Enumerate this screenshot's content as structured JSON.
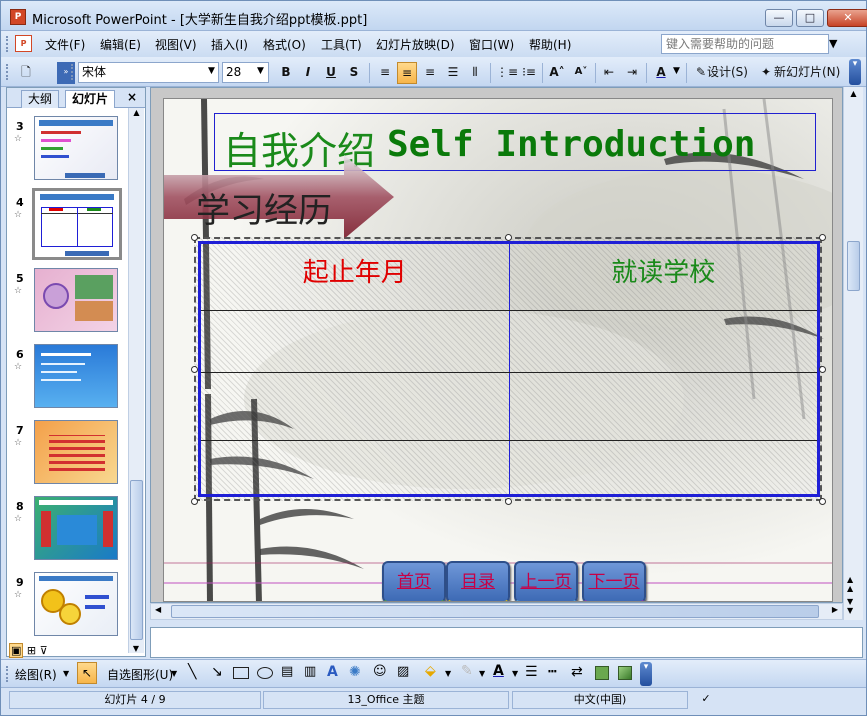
{
  "window": {
    "title": "Microsoft PowerPoint - [大学新生自我介绍ppt模板.ppt]",
    "app_icon_label": "P",
    "minimize": "—",
    "maximize": "□",
    "close": "✕"
  },
  "menu": {
    "items": [
      "文件(F)",
      "编辑(E)",
      "视图(V)",
      "插入(I)",
      "格式(O)",
      "工具(T)",
      "幻灯片放映(D)",
      "窗口(W)",
      "帮助(H)"
    ],
    "help_placeholder": "键入需要帮助的问题"
  },
  "toolbar": {
    "font_name": "宋体",
    "font_size": "28",
    "bold": "B",
    "italic": "I",
    "underline": "U",
    "shadow": "S",
    "design_label": "设计(S)",
    "new_slide_label": "新幻灯片(N)"
  },
  "left_pane": {
    "tab_outline": "大纲",
    "tab_slides": "幻灯片",
    "close": "×",
    "thumbnails": [
      {
        "number": "3"
      },
      {
        "number": "4",
        "selected": true
      },
      {
        "number": "5"
      },
      {
        "number": "6"
      },
      {
        "number": "7"
      },
      {
        "number": "8"
      },
      {
        "number": "9"
      }
    ]
  },
  "slide": {
    "title_cn": "自我介绍",
    "title_en": "Self Introduction",
    "section_label": "学习经历",
    "table": {
      "headers": [
        "起止年月",
        "就读学校"
      ],
      "rows": [
        [
          "",
          ""
        ],
        [
          "",
          ""
        ],
        [
          "",
          ""
        ]
      ]
    },
    "nav_buttons": [
      "首页",
      "目录",
      "上一页",
      "下一页"
    ]
  },
  "draw_toolbar": {
    "draw_label": "绘图(R)",
    "autoshapes_label": "自选图形(U)"
  },
  "status": {
    "slide_position": "幻灯片 4 / 9",
    "theme": "13_Office 主题",
    "language": "中文(中国)"
  },
  "colors": {
    "title_cn": "#1a8a1a",
    "title_en": "#0a7a0a",
    "header_left": "#e00000",
    "header_right": "#1a8a1a",
    "table_border": "#1f1fd6"
  }
}
